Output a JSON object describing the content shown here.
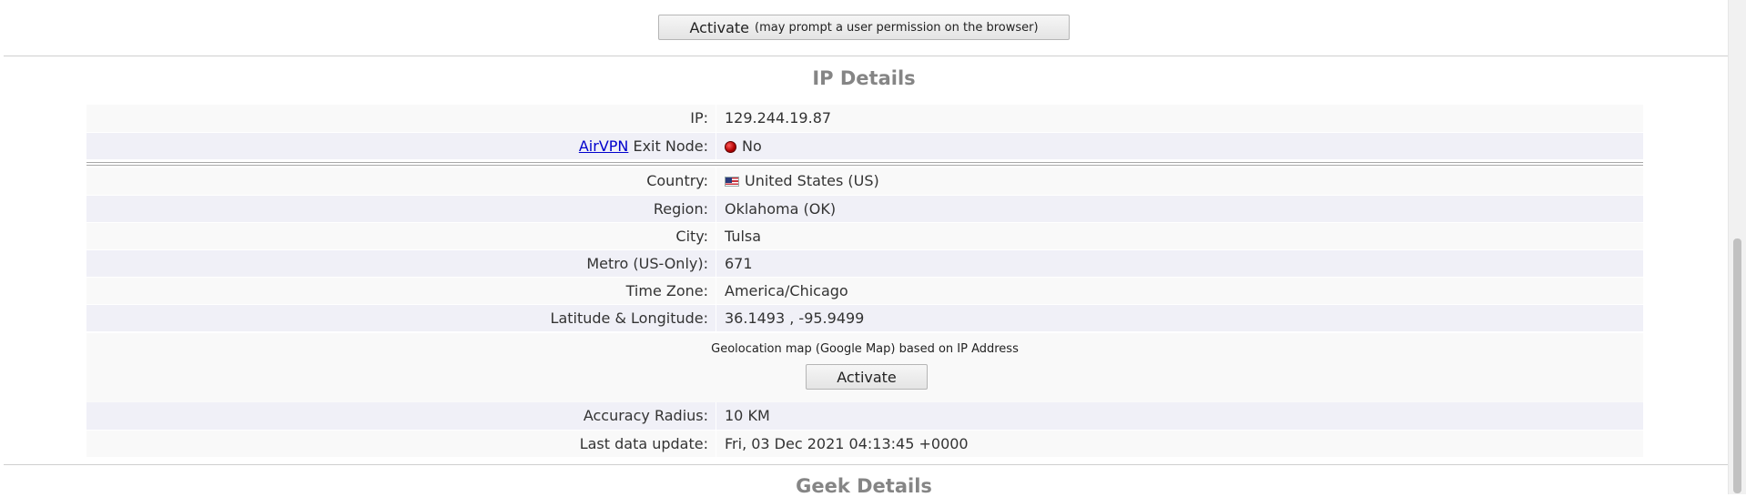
{
  "top_activate": {
    "label": "Activate",
    "note": "(may prompt a user permission on the browser)"
  },
  "ip_section": {
    "title": "IP Details",
    "rows_a": [
      {
        "label": "IP:",
        "value": "129.244.19.87"
      },
      {
        "link": "AirVPN",
        "label": " Exit Node:",
        "value": "No",
        "status_color": "#cc0000"
      }
    ],
    "rows_b": [
      {
        "label": "Country:",
        "value": "United States (US)",
        "icon": "us-flag-icon"
      },
      {
        "label": "Region:",
        "value": "Oklahoma (OK)"
      },
      {
        "label": "City:",
        "value": "Tulsa"
      },
      {
        "label": "Metro (US-Only):",
        "value": "671"
      },
      {
        "label": "Time Zone:",
        "value": "America/Chicago"
      },
      {
        "label": "Latitude & Longitude:",
        "value": "36.1493 , -95.9499"
      }
    ],
    "map": {
      "caption": "Geolocation map (Google Map) based on IP Address",
      "button": "Activate"
    },
    "rows_c": [
      {
        "label": "Accuracy Radius:",
        "value": "10 KM"
      },
      {
        "label": "Last data update:",
        "value": "Fri, 03 Dec 2021 04:13:45 +0000"
      }
    ]
  },
  "geek_section": {
    "title": "Geek Details"
  }
}
